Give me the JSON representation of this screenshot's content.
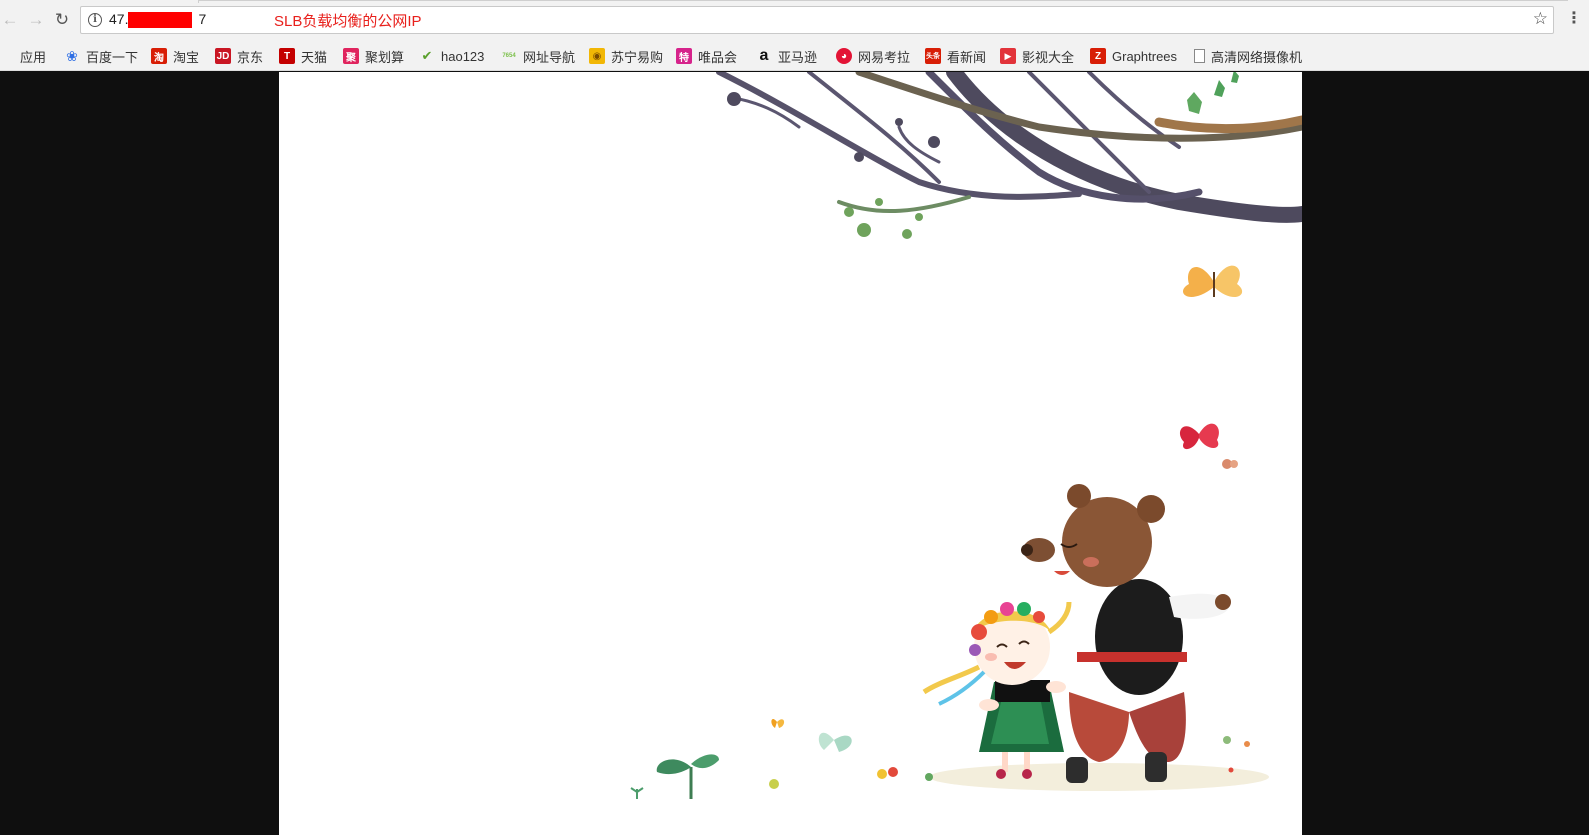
{
  "browser": {
    "url": "47.",
    "url_tail": "7",
    "annotation": "SLB负载均衡的公网IP",
    "icons": [
      "back-icon",
      "forward-icon",
      "reload-icon",
      "info-icon",
      "star-icon",
      "menu-icon"
    ]
  },
  "bookmarks": [
    {
      "label": "应用",
      "icon": "apps-grid-icon",
      "color": "#4285f4"
    },
    {
      "label": "百度一下",
      "icon": "baidu-paw-icon",
      "color": "#2f6fe4"
    },
    {
      "label": "淘宝",
      "icon": "taobao-icon",
      "color": "#d81e06"
    },
    {
      "label": "京东",
      "icon": "jd-icon",
      "color": "#c91623"
    },
    {
      "label": "天猫",
      "icon": "tmall-icon",
      "color": "#c40000"
    },
    {
      "label": "聚划算",
      "icon": "juhuasuan-icon",
      "color": "#e0245e"
    },
    {
      "label": "hao123",
      "icon": "hao123-icon",
      "color": "#5aa02c"
    },
    {
      "label": "网址导航",
      "icon": "7654-icon",
      "color": "#7cc04b"
    },
    {
      "label": "苏宁易购",
      "icon": "suning-icon",
      "color": "#f2b705"
    },
    {
      "label": "唯品会",
      "icon": "vip-icon",
      "color": "#d6238b"
    },
    {
      "label": "亚马逊",
      "icon": "amazon-icon",
      "color": "#111111"
    },
    {
      "label": "网易考拉",
      "icon": "kaola-icon",
      "color": "#e31436"
    },
    {
      "label": "看新闻",
      "icon": "news-icon",
      "color": "#d81e06"
    },
    {
      "label": "影视大全",
      "icon": "video-icon",
      "color": "#e2333a"
    },
    {
      "label": "Graphtrees",
      "icon": "graphtrees-icon",
      "color": "#d81e06"
    },
    {
      "label": "高清网络摄像机",
      "icon": "page-icon",
      "color": "#888888"
    }
  ],
  "page": {
    "illustration": "bear-and-girl-illustration",
    "background": "#ffffff",
    "side_color": "#0f0f0f"
  }
}
